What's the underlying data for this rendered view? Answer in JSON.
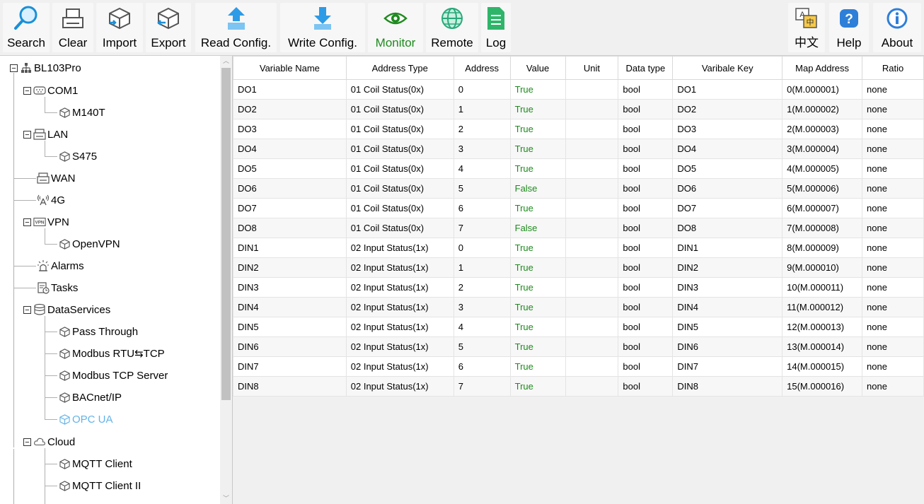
{
  "toolbar": {
    "buttons": [
      {
        "label": "Search",
        "icon": "search-icon"
      },
      {
        "label": "Clear",
        "icon": "clear-icon"
      },
      {
        "label": "Import",
        "icon": "import-icon"
      },
      {
        "label": "Export",
        "icon": "export-icon"
      },
      {
        "label": "Read Config.",
        "icon": "read-config-icon"
      },
      {
        "label": "Write Config.",
        "icon": "write-config-icon"
      },
      {
        "label": "Monitor",
        "icon": "monitor-icon"
      },
      {
        "label": "Remote",
        "icon": "remote-icon"
      },
      {
        "label": "Log",
        "icon": "log-icon"
      },
      {
        "label": "中文",
        "icon": "language-icon"
      },
      {
        "label": "Help",
        "icon": "help-icon"
      },
      {
        "label": "About",
        "icon": "about-icon"
      }
    ],
    "active": "Monitor"
  },
  "tree": {
    "root": "BL103Pro",
    "items": [
      {
        "label": "COM1"
      },
      {
        "label": "M140T"
      },
      {
        "label": "LAN"
      },
      {
        "label": "S475"
      },
      {
        "label": "WAN"
      },
      {
        "label": "4G"
      },
      {
        "label": "VPN"
      },
      {
        "label": "OpenVPN"
      },
      {
        "label": "Alarms"
      },
      {
        "label": "Tasks"
      },
      {
        "label": "DataServices"
      },
      {
        "label": "Pass Through"
      },
      {
        "label": "Modbus RTU⇆TCP"
      },
      {
        "label": "Modbus TCP Server"
      },
      {
        "label": "BACnet/IP"
      },
      {
        "label": "OPC UA"
      },
      {
        "label": "Cloud"
      },
      {
        "label": "MQTT Client"
      },
      {
        "label": "MQTT Client II"
      }
    ],
    "selected": "OPC UA",
    "expander": "−"
  },
  "table": {
    "columns": [
      "Variable Name",
      "Address Type",
      "Address",
      "Value",
      "Unit",
      "Data type",
      "Varibale Key",
      "Map Address",
      "Ratio"
    ],
    "rows": [
      [
        "DO1",
        "01 Coil Status(0x)",
        "0",
        "True",
        "",
        "bool",
        "DO1",
        "0(M.000001)",
        "none"
      ],
      [
        "DO2",
        "01 Coil Status(0x)",
        "1",
        "True",
        "",
        "bool",
        "DO2",
        "1(M.000002)",
        "none"
      ],
      [
        "DO3",
        "01 Coil Status(0x)",
        "2",
        "True",
        "",
        "bool",
        "DO3",
        "2(M.000003)",
        "none"
      ],
      [
        "DO4",
        "01 Coil Status(0x)",
        "3",
        "True",
        "",
        "bool",
        "DO4",
        "3(M.000004)",
        "none"
      ],
      [
        "DO5",
        "01 Coil Status(0x)",
        "4",
        "True",
        "",
        "bool",
        "DO5",
        "4(M.000005)",
        "none"
      ],
      [
        "DO6",
        "01 Coil Status(0x)",
        "5",
        "False",
        "",
        "bool",
        "DO6",
        "5(M.000006)",
        "none"
      ],
      [
        "DO7",
        "01 Coil Status(0x)",
        "6",
        "True",
        "",
        "bool",
        "DO7",
        "6(M.000007)",
        "none"
      ],
      [
        "DO8",
        "01 Coil Status(0x)",
        "7",
        "False",
        "",
        "bool",
        "DO8",
        "7(M.000008)",
        "none"
      ],
      [
        "DIN1",
        "02 Input Status(1x)",
        "0",
        "True",
        "",
        "bool",
        "DIN1",
        "8(M.000009)",
        "none"
      ],
      [
        "DIN2",
        "02 Input Status(1x)",
        "1",
        "True",
        "",
        "bool",
        "DIN2",
        "9(M.000010)",
        "none"
      ],
      [
        "DIN3",
        "02 Input Status(1x)",
        "2",
        "True",
        "",
        "bool",
        "DIN3",
        "10(M.000011)",
        "none"
      ],
      [
        "DIN4",
        "02 Input Status(1x)",
        "3",
        "True",
        "",
        "bool",
        "DIN4",
        "11(M.000012)",
        "none"
      ],
      [
        "DIN5",
        "02 Input Status(1x)",
        "4",
        "True",
        "",
        "bool",
        "DIN5",
        "12(M.000013)",
        "none"
      ],
      [
        "DIN6",
        "02 Input Status(1x)",
        "5",
        "True",
        "",
        "bool",
        "DIN6",
        "13(M.000014)",
        "none"
      ],
      [
        "DIN7",
        "02 Input Status(1x)",
        "6",
        "True",
        "",
        "bool",
        "DIN7",
        "14(M.000015)",
        "none"
      ],
      [
        "DIN8",
        "02 Input Status(1x)",
        "7",
        "True",
        "",
        "bool",
        "DIN8",
        "15(M.000016)",
        "none"
      ]
    ]
  },
  "colors": {
    "active_text": "#1f8a1f",
    "selected_tree": "#63b3e8",
    "value_text": "#1f8a1f"
  }
}
